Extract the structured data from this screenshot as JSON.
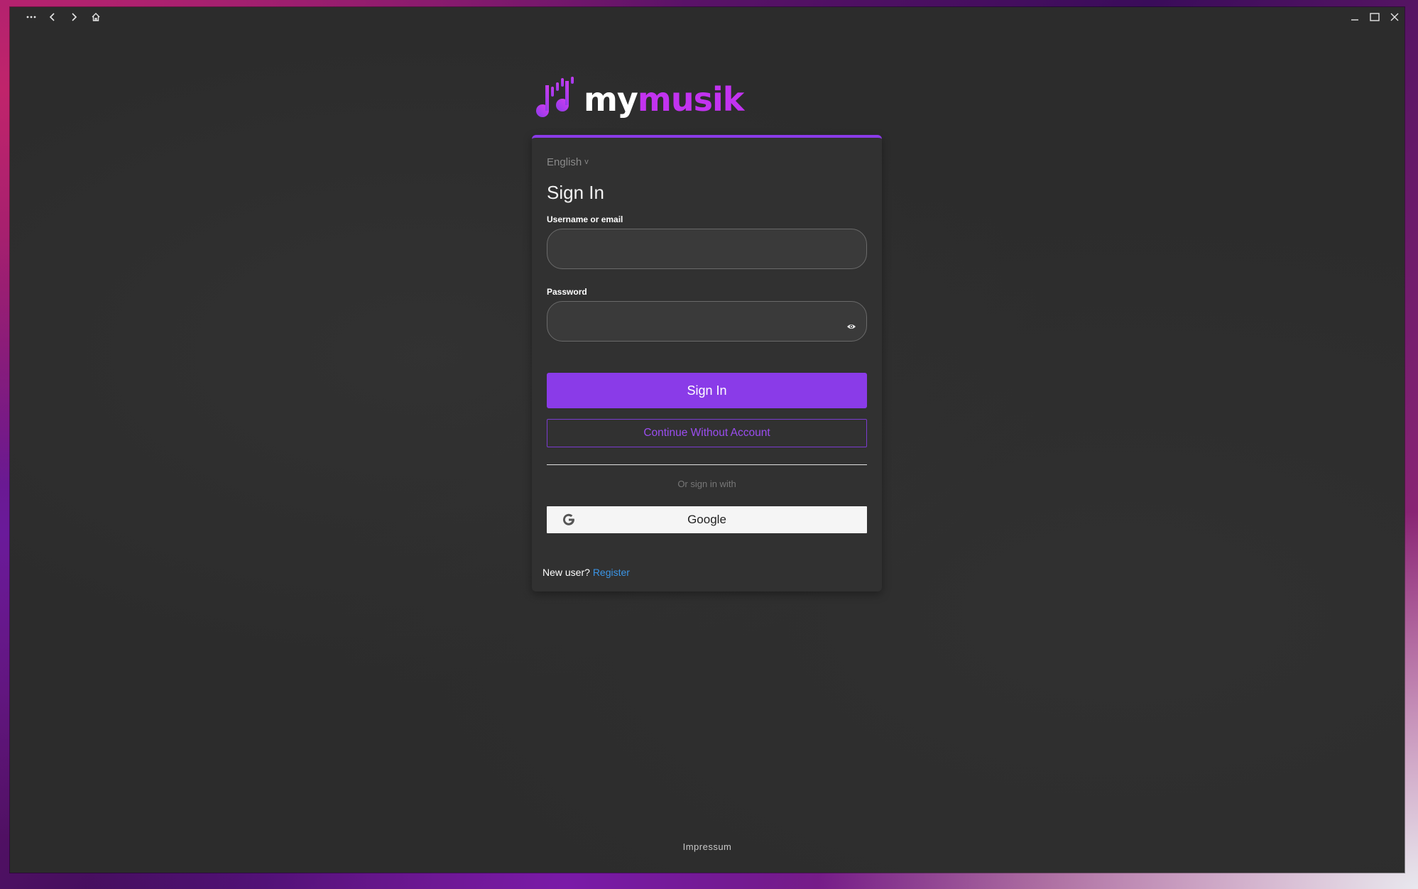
{
  "window": {
    "menu_icon": "more-horizontal-icon",
    "back_icon": "chevron-left-icon",
    "forward_icon": "chevron-right-icon",
    "home_icon": "home-icon",
    "minimize_icon": "minimize-icon",
    "maximize_icon": "maximize-icon",
    "close_icon": "close-icon"
  },
  "logo": {
    "text_my": "my",
    "text_musik": "musik",
    "icon": "music-note-logo-icon",
    "colors": {
      "my": "#ffffff",
      "musik": "#c233f0",
      "icon_start": "#8a3be8",
      "icon_end": "#d63cf0"
    }
  },
  "login": {
    "language": "English",
    "language_chevron": "v",
    "title": "Sign In",
    "username_label": "Username or email",
    "username_value": "",
    "password_label": "Password",
    "password_value": "",
    "password_toggle_icon": "eye-icon",
    "sign_in_button": "Sign In",
    "continue_button": "Continue Without Account",
    "or_text": "Or sign in with",
    "google_button": "Google",
    "google_icon": "google-g-icon",
    "new_user_text": "New user?",
    "register_link": "Register"
  },
  "footer": {
    "impressum": "Impressum"
  },
  "colors": {
    "accent": "#8a3be8",
    "link": "#3b95e6",
    "background": "#2c2c2c",
    "card": "#313131"
  }
}
